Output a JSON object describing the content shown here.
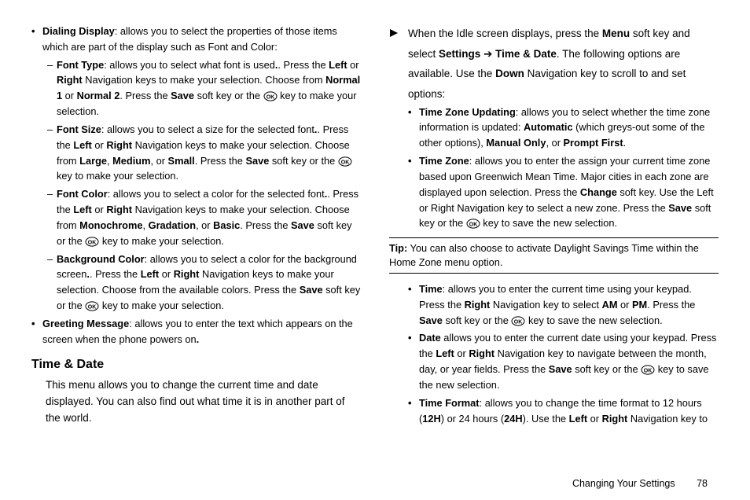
{
  "left": {
    "dialing": {
      "lead_b": "Dialing Display",
      "lead_t": ": allows you to select the properties of those items which are part of the display such as Font and Color:",
      "font_type": {
        "b": "Font Type",
        "p1": ": allows you to select what font is used",
        "p2": ". Press the ",
        "b2": "Left",
        "or": " or ",
        "b3": "Right",
        "p3": " Navigation keys to make your selection. Choose from ",
        "b4": "Normal 1",
        "or2": " or ",
        "b5": "Normal 2",
        "p4": ". Press the ",
        "b6": "Save",
        "p5": " soft key or the ",
        "p6": " key to make your selection."
      },
      "font_size": {
        "b": "Font Size",
        "p1": ": allows you to select a size for the selected font",
        "p2": ". Press the ",
        "b2": "Left",
        "or": " or ",
        "b3": "Right",
        "p3": " Navigation keys to make your selection. Choose from ",
        "b4": "Large",
        "c1": ", ",
        "b5": "Medium",
        "c2": ", or ",
        "b6": "Small",
        "p4": ". Press the ",
        "b7": "Save",
        "p5": " soft key or the ",
        "p6": " key to make your selection."
      },
      "font_color": {
        "b": "Font Color",
        "p1": ": allows you to select a color for the selected font",
        "p2": ". Press the ",
        "b2": "Left",
        "or": " or ",
        "b3": "Right",
        "p3": " Navigation keys to make your selection. Choose from ",
        "b4": "Monochrome",
        "c1": ", ",
        "b5": "Gradation",
        "c2": ", or ",
        "b6": "Basic",
        "p4": ". Press the ",
        "b7": "Save",
        "p5": " soft key or the ",
        "p6": " key to make your selection."
      },
      "bg_color": {
        "b": "Background Color",
        "p1": ": allows you to select a color for the background screen",
        "p2": ". Press the ",
        "b2": "Left",
        "or": " or ",
        "b3": "Right",
        "p3": " Navigation keys to make your selection. Choose from the available colors. Press the ",
        "b4": "Save",
        "p4": " soft key or the ",
        "p5": " key to make your selection."
      }
    },
    "greeting": {
      "b": "Greeting Message",
      "t": ": allows you to enter the text which appears on the screen when the phone powers on",
      "dot": "."
    },
    "heading": "Time & Date",
    "intro": "This menu allows you to change the current time and date displayed. You can also find out what time it is in another part of the world."
  },
  "right": {
    "idle": {
      "p1": "When the Idle screen displays, press the ",
      "b1": "Menu",
      "p2": " soft key and select ",
      "b2": "Settings",
      "arrow": " ➔ ",
      "b3": "Time & Date",
      "p3": ". The following options are available. Use the ",
      "b4": "Down",
      "p4": " Navigation key to scroll to and set options:"
    },
    "tzu": {
      "b": "Time Zone Updating",
      "p1": ": allows you to select whether the time zone information is updated: ",
      "b2": "Automatic",
      "p2": " (which greys-out some of the other options), ",
      "b3": "Manual Only",
      "c": ", or ",
      "b4": "Prompt First",
      "dot": "."
    },
    "tz": {
      "b": "Time Zone",
      "p1": ": allows you to enter the assign your current time zone based upon Greenwich Mean Time. Major cities in each zone are displayed upon selection. Press the ",
      "b2": "Change",
      "p2": " soft key. Use the Left or Right Navigation key to select a new zone. Press the ",
      "b3": "Save",
      "p3": " soft key or the ",
      "p4": " key to save the new selection."
    },
    "tip_b": "Tip:",
    "tip": " You can also choose to activate Daylight Savings Time within the Home Zone menu option.",
    "time": {
      "b": "Time",
      "p1": ": allows you to enter the current time using your keypad. Press the ",
      "b2": "Right",
      "p2": " Navigation key to select ",
      "b3": "AM",
      "or": " or ",
      "b4": "PM",
      "p3": ". Press the ",
      "b5": "Save",
      "p4": " soft key or the ",
      "p5": " key to save the new selection."
    },
    "date": {
      "b": "Date",
      "p1": " allows you to enter the current date using your keypad. Press the ",
      "b2": "Left",
      "or": " or ",
      "b3": "Right",
      "p2": " Navigation key to navigate between the month, day, or year fields. Press the ",
      "b4": "Save",
      "p3": " soft key or the ",
      "p4": " key to save the new selection."
    },
    "tfmt": {
      "b": "Time Format",
      "p1": ": allows you to change the time format to 12 hours (",
      "b2": "12H",
      "p2": ") or 24 hours (",
      "b3": "24H",
      "p3": "). Use the ",
      "b4": "Left",
      "or": " or ",
      "b5": "Right",
      "p4": " Navigation key to"
    }
  },
  "footer": {
    "label": "Changing Your Settings",
    "page": "78"
  }
}
